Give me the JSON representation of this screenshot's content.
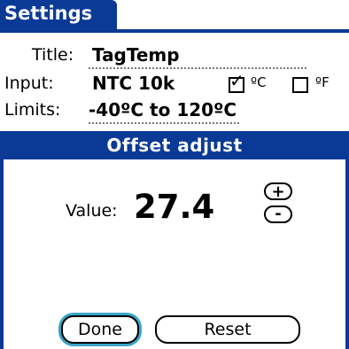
{
  "form": {
    "title": "Settings",
    "rows": {
      "title": {
        "label": "Title:",
        "value": "TagTemp"
      },
      "input": {
        "label": "Input:",
        "value": "NTC 10k"
      },
      "limits": {
        "label": "Limits:",
        "value": "-40ºC to 120ºC"
      }
    },
    "units": {
      "celsius": {
        "label": "ºC",
        "checked": true
      },
      "fahrenheit": {
        "label": "ºF",
        "checked": false
      }
    }
  },
  "dialog": {
    "title": "Offset adjust",
    "value_label": "Value:",
    "value": "27.4",
    "increment_label": "+",
    "decrement_label": "-",
    "done_label": "Done",
    "reset_label": "Reset"
  },
  "colors": {
    "title_bar": "#0b3a96",
    "focus_ring": "#3aa6c8"
  }
}
